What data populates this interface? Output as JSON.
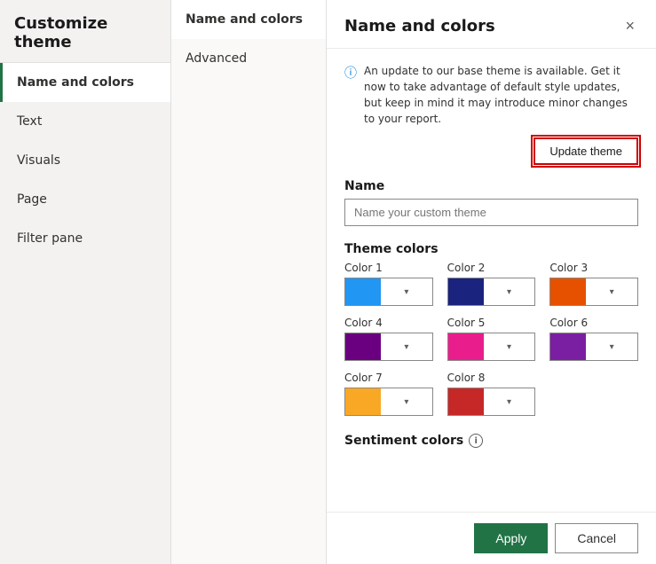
{
  "sidebar": {
    "title": "Customize theme",
    "items": [
      {
        "id": "name-and-colors",
        "label": "Name and colors",
        "active": true
      },
      {
        "id": "text",
        "label": "Text",
        "active": false
      },
      {
        "id": "visuals",
        "label": "Visuals",
        "active": false
      },
      {
        "id": "page",
        "label": "Page",
        "active": false
      },
      {
        "id": "filter-pane",
        "label": "Filter pane",
        "active": false
      }
    ]
  },
  "center_panel": {
    "tabs": [
      {
        "id": "name-and-colors-tab",
        "label": "Name and colors",
        "active": true
      },
      {
        "id": "advanced-tab",
        "label": "Advanced",
        "active": false
      }
    ]
  },
  "main": {
    "title": "Name and colors",
    "close_icon": "×",
    "info_text": "An update to our base theme is available. Get it now to take advantage of default style updates, but keep in mind it may introduce minor changes to your report.",
    "update_theme_label": "Update theme",
    "name_section": {
      "label": "Name",
      "placeholder": "Name your custom theme",
      "value": ""
    },
    "theme_colors_label": "Theme colors",
    "colors": [
      {
        "id": "color1",
        "label": "Color 1",
        "color": "#2196F3"
      },
      {
        "id": "color2",
        "label": "Color 2",
        "color": "#1a237e"
      },
      {
        "id": "color3",
        "label": "Color 3",
        "color": "#e65100"
      },
      {
        "id": "color4",
        "label": "Color 4",
        "color": "#6a0080"
      },
      {
        "id": "color5",
        "label": "Color 5",
        "color": "#e91e8c"
      },
      {
        "id": "color6",
        "label": "Color 6",
        "color": "#7b1fa2"
      },
      {
        "id": "color7",
        "label": "Color 7",
        "color": "#f9a825"
      },
      {
        "id": "color8",
        "label": "Color 8",
        "color": "#c62828"
      }
    ],
    "sentiment_colors_label": "Sentiment colors",
    "footer": {
      "apply_label": "Apply",
      "cancel_label": "Cancel"
    }
  }
}
